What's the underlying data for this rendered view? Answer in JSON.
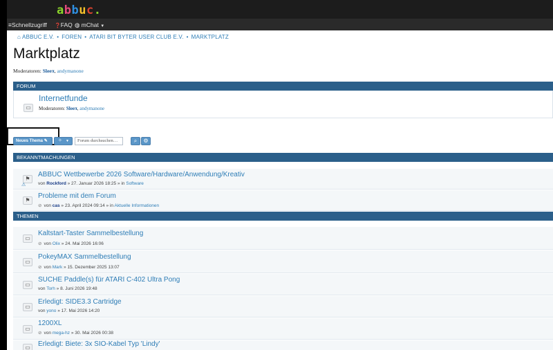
{
  "colors": {
    "accent": "#2e7db6",
    "section_header": "#2b5f8a",
    "button": "#5a96c8",
    "header_dark": "#1c1c1c"
  },
  "logo": {
    "letters": [
      "a",
      "b",
      "b",
      "u",
      "c",
      "."
    ],
    "letter_colors": [
      "#8bd42b",
      "#e54a7c",
      "#2f8fe0",
      "#f5c02a",
      "#d6432f",
      "#8bd42b"
    ]
  },
  "nav": {
    "quick_access": {
      "icon": "hamburger-icon",
      "label": "Schnellzugriff"
    },
    "faq": {
      "icon": "question-icon",
      "label": "FAQ"
    },
    "chat": {
      "icon": "chat-icon",
      "label": "mChat"
    }
  },
  "breadcrumb": [
    "ABBUC E.V.",
    "FOREN",
    "ATARI BIT BYTER USER CLUB E.V.",
    "MARKTPLATZ"
  ],
  "page": {
    "title": "Marktplatz",
    "moderators_label": "Moderatoren:",
    "moderators": [
      "Sleeπ",
      "andymanone"
    ]
  },
  "forum_section": {
    "header": "FORUM",
    "forums": [
      {
        "name": "Internetfunde",
        "moderators_label": "Moderatoren:",
        "moderators": [
          "Sleeπ",
          "andymanone"
        ]
      }
    ]
  },
  "actions": {
    "new_topic_label": "Neues Thema",
    "new_topic_icon": "pencil-icon",
    "tools_icon": "wrench-icon",
    "dropdown_icon": "chevron-down-icon",
    "search_placeholder": "Forum durchsuchen…",
    "search_icon": "search-icon",
    "advanced_search_icon": "gear-icon"
  },
  "announcements": {
    "header": "BEKANNTMACHUNGEN",
    "topics": [
      {
        "title": "ABBUC Wettbewerbe 2026 Software/Hardware/Anwendung/Kreativ",
        "by": "von",
        "author": "Rockford",
        "date": "» 27. Januar 2026 18:25 »",
        "in": "in",
        "forum": "Software",
        "attachment": false,
        "author_bold": true
      },
      {
        "title": "Probleme mit dem Forum",
        "by": "von",
        "author": "cas",
        "date": "» 23. April 2024 09:14 »",
        "in": "in",
        "forum": "Aktuelle Informationen",
        "attachment": true,
        "author_bold": true
      }
    ]
  },
  "topics_section": {
    "header": "THEMEN",
    "topics": [
      {
        "title": "Kaltstart-Taster Sammelbestellung",
        "by": "von",
        "author": "Olix",
        "date": "» 24. Mai 2026 16:06",
        "attachment": true
      },
      {
        "title": "PokeyMAX Sammelbestellung",
        "by": "von",
        "author": "Mark",
        "date": "» 15. Dezember 2025 13:07",
        "attachment": true
      },
      {
        "title": "SUCHE Paddle(s) für ATARI C-402 Ultra Pong",
        "by": "von",
        "author": "Torh",
        "date": "» 8. Juni 2026 19:48",
        "attachment": false
      },
      {
        "title": "Erledigt: SIDE3.3 Cartridge",
        "by": "von",
        "author": "yono",
        "date": "» 17. Mai 2026 14:20",
        "attachment": false
      },
      {
        "title": "1200XL",
        "by": "von",
        "author": "mega-hz",
        "date": "» 30. Mai 2026 00:38",
        "attachment": true
      },
      {
        "title": "Erledigt: Biete: 3x SIO-Kabel Typ 'Lindy'",
        "by": "",
        "author": "",
        "date": "",
        "attachment": false
      }
    ]
  }
}
